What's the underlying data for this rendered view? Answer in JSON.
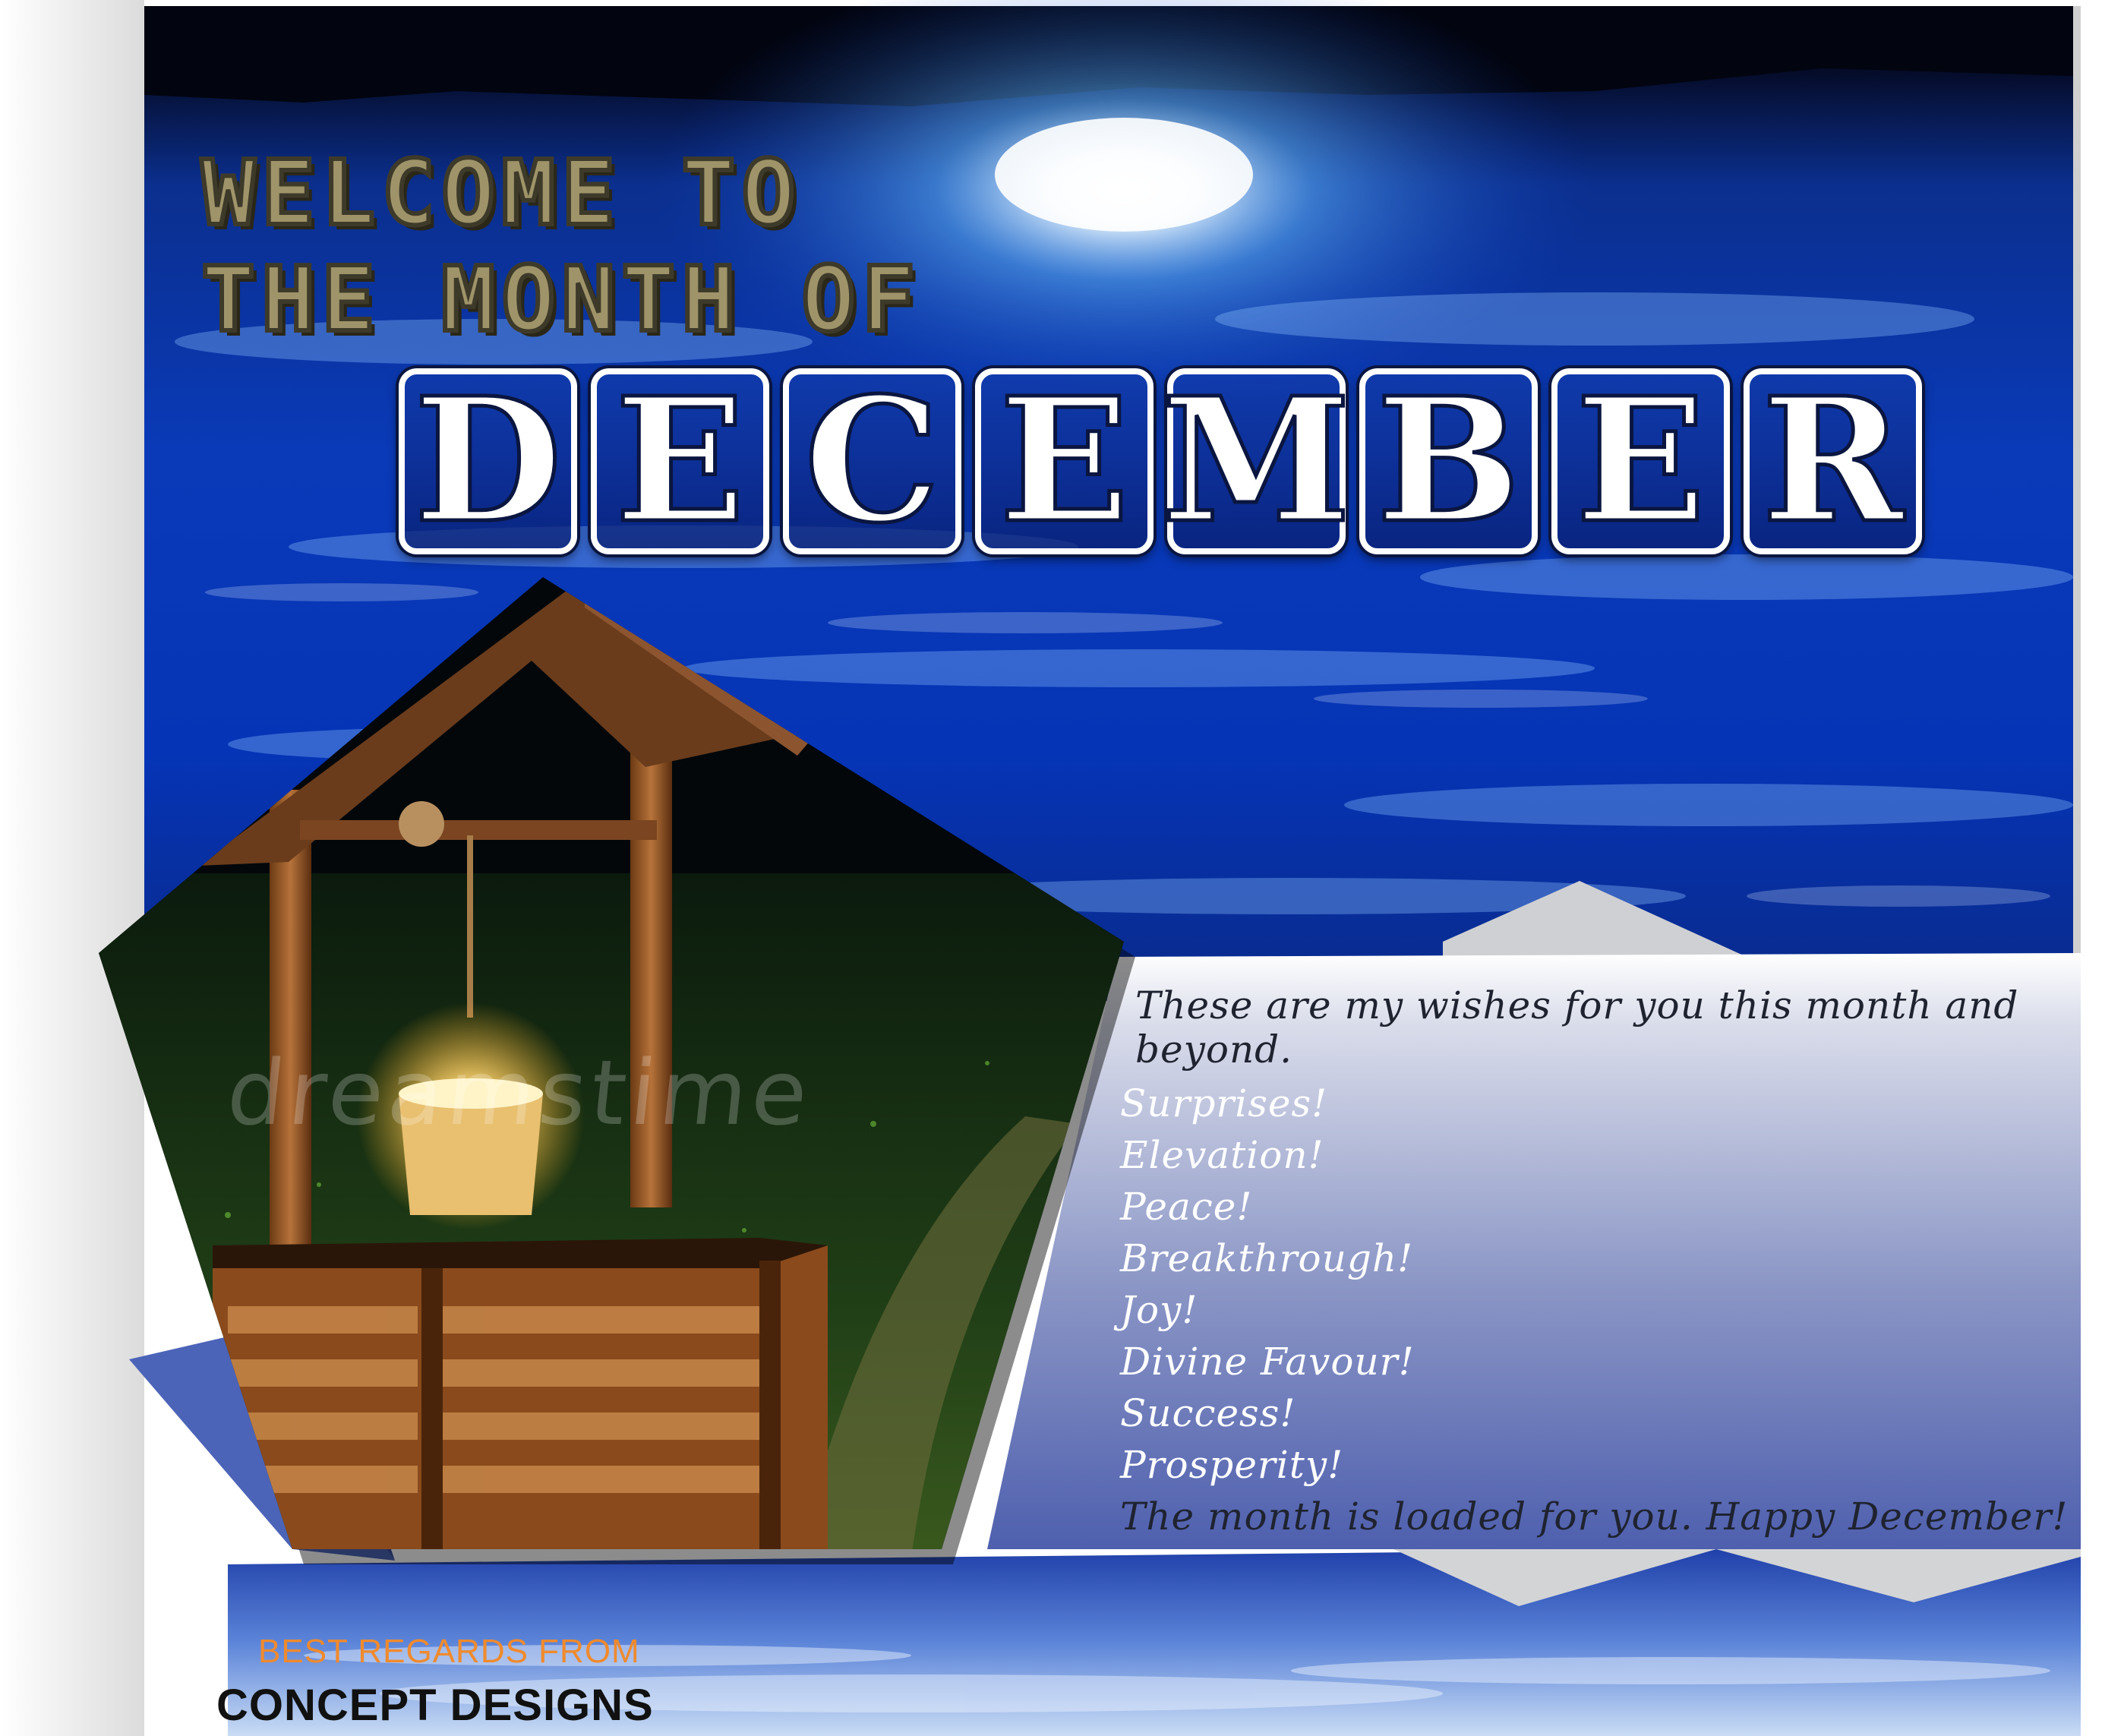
{
  "header": {
    "line1": "WELCOME TO",
    "line2": "THE MONTH OF",
    "month_letters": [
      "D",
      "E",
      "C",
      "E",
      "M",
      "B",
      "E",
      "R"
    ]
  },
  "wishes": {
    "intro": "These are my wishes for you this month and beyond.",
    "items": [
      "Surprises!",
      "Elevation!",
      "Peace!",
      "Breakthrough!",
      "Joy!",
      "Divine Favour!",
      "Success!",
      "Prosperity!"
    ],
    "closing": "The month is loaded for you. Happy December!"
  },
  "footer": {
    "regards_label": "BEST REGARDS FROM",
    "brand": "CONCEPT DESIGNS"
  },
  "image_watermark": "dreamstime",
  "colors": {
    "sky_dark": "#02061a",
    "sky_blue": "#0b3fc4",
    "headline_gold": "#9f9469",
    "panel_blue": "#5a6bb0",
    "accent_orange": "#f08a2c"
  }
}
